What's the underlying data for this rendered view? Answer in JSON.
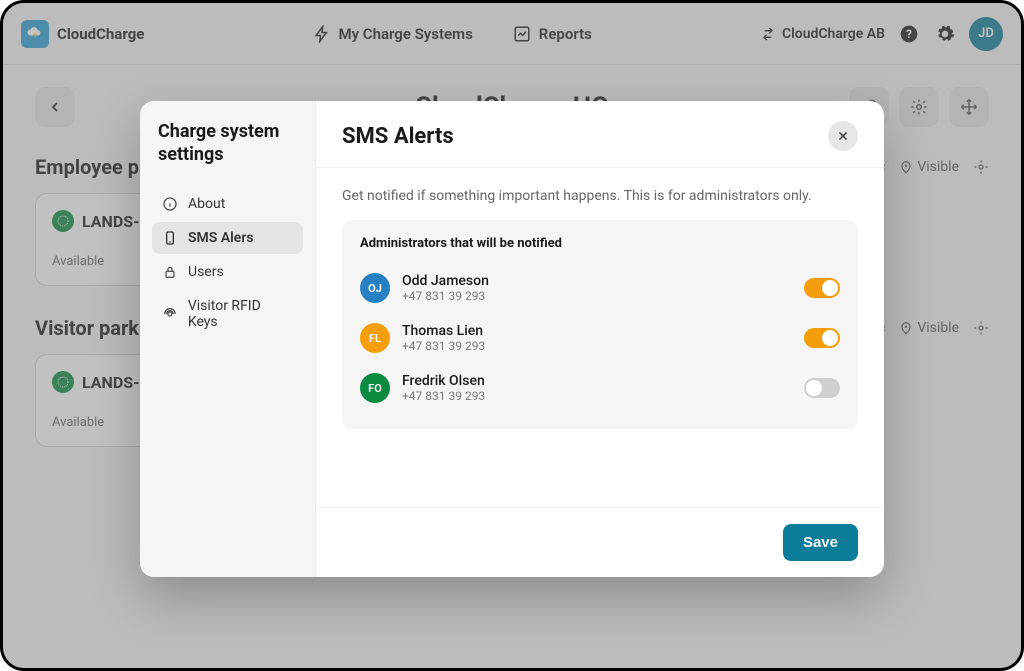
{
  "brand": {
    "name": "CloudCharge"
  },
  "nav": {
    "my_charge_systems": "My Charge Systems",
    "reports": "Reports"
  },
  "org": {
    "name": "CloudCharge AB"
  },
  "avatar": {
    "initials": "JD"
  },
  "page": {
    "title": "CloudCharge HQ"
  },
  "sections": [
    {
      "title": "Employee parking",
      "meta_public": "Public",
      "meta_visible": "Visible",
      "card": {
        "name": "LANDS-0",
        "status": "Available"
      }
    },
    {
      "title": "Visitor parking",
      "meta_public": "Public",
      "meta_visible": "Visible",
      "card": {
        "name": "LANDS-0",
        "status": "Available"
      }
    }
  ],
  "modal": {
    "side_title": "Charge system settings",
    "side_items": [
      {
        "label": "About",
        "active": false
      },
      {
        "label": "SMS Alers",
        "active": true
      },
      {
        "label": "Users",
        "active": false
      },
      {
        "label": "Visitor RFID Keys",
        "active": false
      }
    ],
    "title": "SMS Alerts",
    "description": "Get notified if something important happens. This is for administrators only.",
    "panel_title": "Administrators that will be notified",
    "admins": [
      {
        "initials": "OJ",
        "name": "Odd Jameson",
        "phone": "+47 831 39 293",
        "enabled": true,
        "color": "#2880c4"
      },
      {
        "initials": "FL",
        "name": "Thomas Lien",
        "phone": "+47 831 39 293",
        "enabled": true,
        "color": "#f59e0b"
      },
      {
        "initials": "FO",
        "name": "Fredrik Olsen",
        "phone": "+47 831 39 293",
        "enabled": false,
        "color": "#0a8a3e"
      }
    ],
    "save_label": "Save"
  }
}
